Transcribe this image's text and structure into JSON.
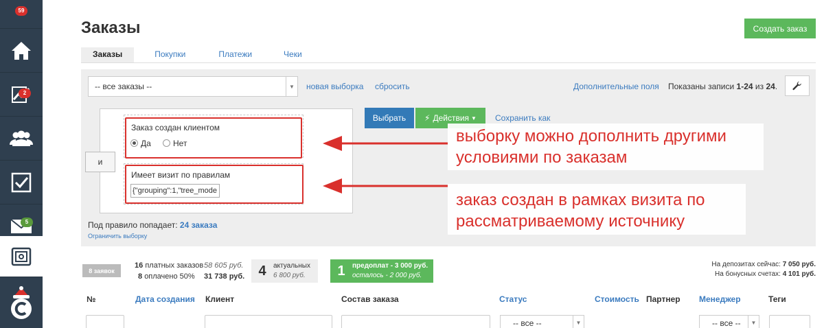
{
  "sidebar": {
    "badges": {
      "top": "59",
      "stats": "2",
      "mail": "5"
    },
    "icons": [
      "home-icon",
      "chart-icon",
      "users-icon",
      "checkbox-icon",
      "mail-icon",
      "safe-icon",
      "logo-icon"
    ]
  },
  "header": {
    "title": "Заказы",
    "create_button": "Создать заказ",
    "tabs": [
      "Заказы",
      "Покупки",
      "Платежи",
      "Чеки"
    ]
  },
  "filter": {
    "select_value": "-- все заказы --",
    "new_selection": "новая выборка",
    "reset": "сбросить",
    "extra_fields": "Дополнительные поля",
    "shown_prefix": "Показаны записи ",
    "shown_range": "1-24",
    "shown_mid": " из ",
    "shown_total": "24",
    "shown_suffix": ".",
    "and_label": "и",
    "condition1_label": "Заказ создан клиентом",
    "yes": "Да",
    "no": "Нет",
    "condition2_label": "Имеет визит по правилам",
    "condition2_value": "{\"grouping\":1,\"tree_mode",
    "select_button": "Выбрать",
    "actions_button": "Действия",
    "save_as": "Сохранить как",
    "rule_prefix": "Под правило попадает: ",
    "rule_count": "24 заказа",
    "limit_link": "Ограничить выборку"
  },
  "callouts": {
    "first": "выборку можно дополнить другими условиями по заказам",
    "second": "заказ создан в рамках визита по рассматриваемому источнику"
  },
  "stats": {
    "orders_badge": "8 заявок",
    "paid_count": "16",
    "paid_label": "платных заказов",
    "paid_sum": "58 605 руб.",
    "paid50_count": "8",
    "paid50_label": "оплачено 50%",
    "paid50_sum": "31 738 руб.",
    "actual_count": "4",
    "actual_label": "актуальных",
    "actual_sum": "6 800 руб.",
    "prepay_count": "1",
    "prepay_line1": "предоплат - 3 000 руб.",
    "prepay_line2": "осталось - 2 000 руб.",
    "deposits_label": "На депозитах сейчас: ",
    "deposits_value": "7 050 руб.",
    "bonus_label": "На бонусных счетах: ",
    "bonus_value": "4 101 руб."
  },
  "table": {
    "columns": [
      "№",
      "Дата создания",
      "Клиент",
      "Состав заказа",
      "Статус",
      "Стоимость",
      "Партнер",
      "Менеджер",
      "Теги"
    ],
    "status_filter": "-- все --",
    "manager_filter": "-- все --"
  },
  "colors": {
    "sidebar": "#2f3f4f",
    "accent_red": "#d9302c",
    "primary": "#337ab7",
    "success": "#5cb85c",
    "link": "#3b7bbf"
  }
}
